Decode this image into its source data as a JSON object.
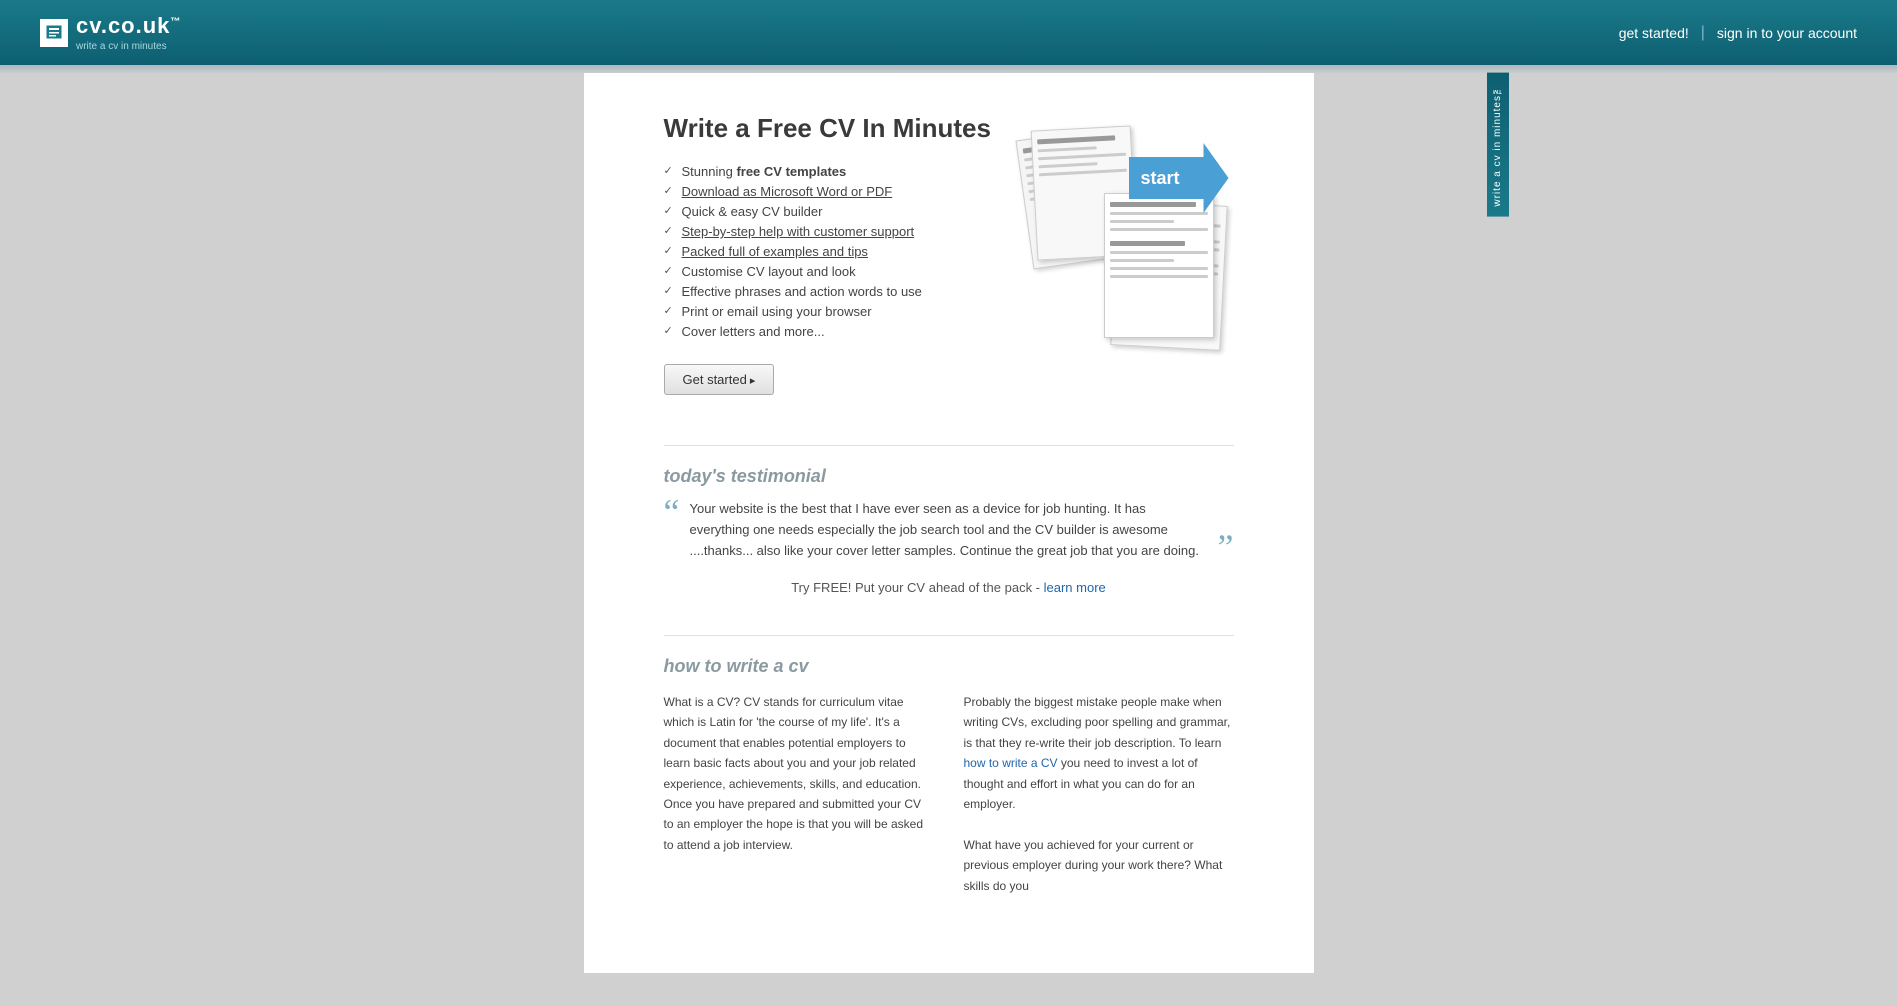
{
  "header": {
    "logo_text": "cv.co.uk",
    "logo_tm": "™",
    "logo_tagline": "write a cv in minutes",
    "get_started_label": "get started!",
    "nav_divider": "|",
    "sign_in_label": "sign in to your account"
  },
  "side_tab": {
    "label": "write a cv in minutes™"
  },
  "hero": {
    "title": "Write a Free CV In Minutes",
    "features": [
      {
        "text": "Stunning ",
        "bold": "free CV templates"
      },
      {
        "text": "Download as Microsoft Word or PDF",
        "underline": true
      },
      {
        "text": "Quick & easy CV builder"
      },
      {
        "text": "Step-by-step help with customer support",
        "underline": true
      },
      {
        "text": "Packed full of examples and tips",
        "underline": true
      },
      {
        "text": "Customise CV layout and look"
      },
      {
        "text": "Effective phrases and action words to use"
      },
      {
        "text": "Print or email using your browser"
      },
      {
        "text": "Cover letters and more..."
      }
    ],
    "get_started_btn": "Get started",
    "start_btn_label": "start"
  },
  "testimonial": {
    "section_title": "today's testimonial",
    "quote": "Your website is the best that I have ever seen as a device for job hunting. It has everything one needs especially the job search tool and the CV builder is awesome ....thanks... also like your cover letter samples. Continue the great job that you are doing.",
    "cta_text": "Try FREE! Put your CV ahead of the pack - ",
    "learn_more_label": "learn more"
  },
  "how_to": {
    "section_title": "how to write a cv",
    "col1_text": "What is a CV? CV stands for curriculum vitae which is Latin for 'the course of my life'. It's a document that enables potential employers to learn basic facts about you and your job related experience, achievements, skills, and education. Once you have prepared and submitted your CV to an employer the hope is that you will be asked to attend a job interview.",
    "col2_text_before": "Probably the biggest mistake people make when writing CVs, excluding poor spelling and grammar, is that they re-write their job description. To learn ",
    "col2_link_text": "how to write a CV",
    "col2_text_after": " you need to invest a lot of thought and effort in what you can do for an employer.\n\nWhat have you achieved for your current or previous employer during your work there? What skills do you",
    "col2_link_href": "#"
  }
}
